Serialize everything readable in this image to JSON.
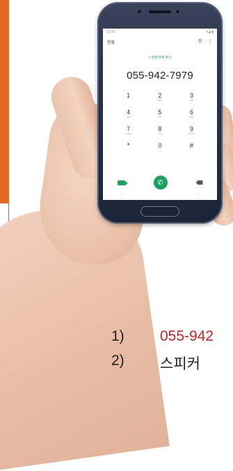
{
  "phone": {
    "status_left": "12:00",
    "status_right": "▾◢ ▮",
    "app_title": "전화",
    "search_icon": "search-icon",
    "more_icon": "more-vert-icon",
    "add_contact": "+ 연락처에 추가",
    "dialed_number": "055-942-7979",
    "keys": [
      {
        "digit": "1",
        "letters": ""
      },
      {
        "digit": "2",
        "letters": "ABC"
      },
      {
        "digit": "3",
        "letters": "DEF"
      },
      {
        "digit": "4",
        "letters": "GHI"
      },
      {
        "digit": "5",
        "letters": "JKL"
      },
      {
        "digit": "6",
        "letters": "MNO"
      },
      {
        "digit": "7",
        "letters": "PQRS"
      },
      {
        "digit": "8",
        "letters": "TUV"
      },
      {
        "digit": "9",
        "letters": "WXYZ"
      },
      {
        "digit": "*",
        "letters": ""
      },
      {
        "digit": "0",
        "letters": "+"
      },
      {
        "digit": "#",
        "letters": ""
      }
    ],
    "call_icon": "✆",
    "nav": [
      "◁",
      "○",
      "□"
    ]
  },
  "instructions": [
    {
      "num": "1)",
      "text": "055-942"
    },
    {
      "num": "2)",
      "text": "스피커"
    }
  ],
  "colors": {
    "accent_bar": "#e2691f",
    "call_green": "#1aa15f",
    "step_highlight": "#d31f1f",
    "phone_body": "#27304a"
  }
}
